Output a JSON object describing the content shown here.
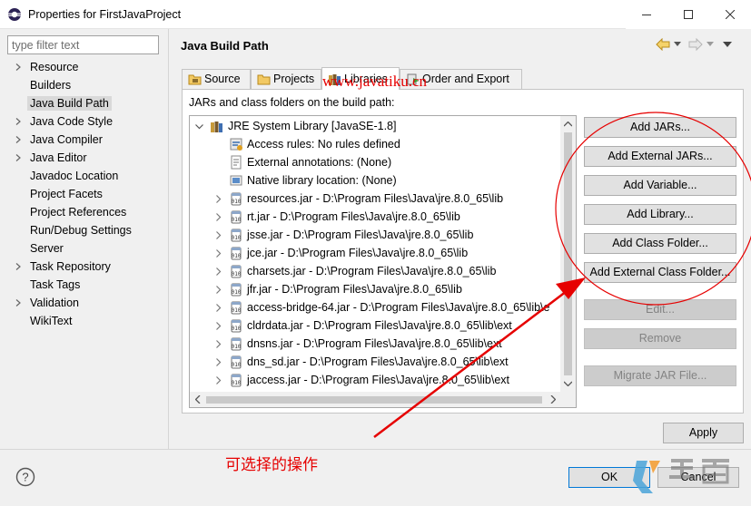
{
  "window": {
    "title": "Properties for FirstJavaProject"
  },
  "filter": {
    "placeholder": "type filter text"
  },
  "nav": {
    "items": [
      {
        "label": "Resource",
        "expandable": true
      },
      {
        "label": "Builders",
        "expandable": false
      },
      {
        "label": "Java Build Path",
        "expandable": false,
        "selected": true
      },
      {
        "label": "Java Code Style",
        "expandable": true
      },
      {
        "label": "Java Compiler",
        "expandable": true
      },
      {
        "label": "Java Editor",
        "expandable": true
      },
      {
        "label": "Javadoc Location",
        "expandable": false
      },
      {
        "label": "Project Facets",
        "expandable": false
      },
      {
        "label": "Project References",
        "expandable": false
      },
      {
        "label": "Run/Debug Settings",
        "expandable": false
      },
      {
        "label": "Server",
        "expandable": false
      },
      {
        "label": "Task Repository",
        "expandable": true
      },
      {
        "label": "Task Tags",
        "expandable": false
      },
      {
        "label": "Validation",
        "expandable": true
      },
      {
        "label": "WikiText",
        "expandable": false
      }
    ]
  },
  "page": {
    "title": "Java Build Path"
  },
  "tabs": [
    {
      "label": "Source",
      "icon": "source-folder-icon"
    },
    {
      "label": "Projects",
      "icon": "projects-folder-icon"
    },
    {
      "label": "Libraries",
      "icon": "libraries-icon",
      "active": true
    },
    {
      "label": "Order and Export",
      "icon": "order-export-icon"
    }
  ],
  "libraries": {
    "label": "JARs and class folders on the build path:",
    "tree": {
      "root": "JRE System Library [JavaSE-1.8]",
      "attributes": [
        {
          "text": "Access rules: No rules defined",
          "icon": "access-rules-icon"
        },
        {
          "text": "External annotations: (None)",
          "icon": "annotations-icon"
        },
        {
          "text": "Native library location: (None)",
          "icon": "native-library-icon"
        }
      ],
      "jars": [
        "resources.jar - D:\\Program Files\\Java\\jre.8.0_65\\lib",
        "rt.jar - D:\\Program Files\\Java\\jre.8.0_65\\lib",
        "jsse.jar - D:\\Program Files\\Java\\jre.8.0_65\\lib",
        "jce.jar - D:\\Program Files\\Java\\jre.8.0_65\\lib",
        "charsets.jar - D:\\Program Files\\Java\\jre.8.0_65\\lib",
        "jfr.jar - D:\\Program Files\\Java\\jre.8.0_65\\lib",
        "access-bridge-64.jar - D:\\Program Files\\Java\\jre.8.0_65\\lib\\e",
        "cldrdata.jar - D:\\Program Files\\Java\\jre.8.0_65\\lib\\ext",
        "dnsns.jar - D:\\Program Files\\Java\\jre.8.0_65\\lib\\ext",
        "dns_sd.jar - D:\\Program Files\\Java\\jre.8.0_65\\lib\\ext",
        "jaccess.jar - D:\\Program Files\\Java\\jre.8.0_65\\lib\\ext"
      ]
    },
    "buttons": {
      "add_jars": "Add JARs...",
      "add_external_jars": "Add External JARs...",
      "add_variable": "Add Variable...",
      "add_library": "Add Library...",
      "add_class_folder": "Add Class Folder...",
      "add_external_class_folder": "Add External Class Folder...",
      "edit": "Edit...",
      "remove": "Remove",
      "migrate_jar": "Migrate JAR File..."
    }
  },
  "apply_label": "Apply",
  "ok_label": "OK",
  "cancel_label": "Cancel",
  "annotations": {
    "watermark": "www.javatiku.cn",
    "caption": "可选择的操作"
  },
  "colors": {
    "annotation_red": "#e60000",
    "selection_gray": "#d9d9d9",
    "default_button_border": "#0078d7"
  }
}
